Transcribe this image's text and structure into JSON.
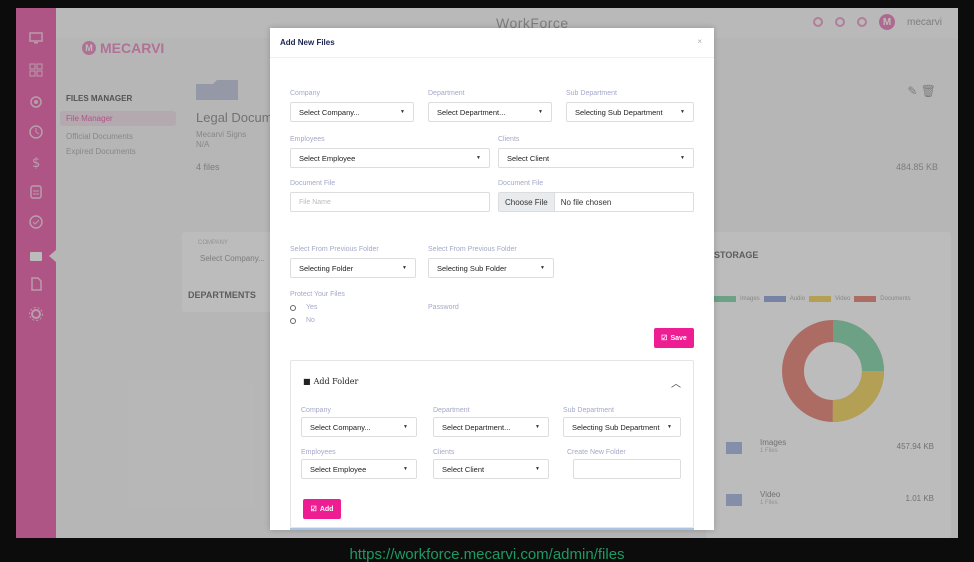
{
  "app": {
    "title": "WorkForce",
    "username": "mecarvi",
    "avatar_initial": "M",
    "logo": "MECARVI",
    "logo_mark": "M"
  },
  "sidebar": {
    "icons": [
      "monitor-icon",
      "grid-icon",
      "settings-icon",
      "clock-icon",
      "dollar-icon",
      "document-icon",
      "check-icon",
      "folder-icon",
      "file-icon",
      "gear-icon"
    ]
  },
  "files_manager": {
    "title": "FILES MANAGER",
    "items": [
      {
        "label": "File Manager"
      },
      {
        "label": "Official Documents"
      },
      {
        "label": "Expired Documents"
      }
    ]
  },
  "folder_detail": {
    "title": "Legal Docume",
    "sub1": "Mecarvi Signs",
    "sub2": "N/A",
    "count": "4 files",
    "size": "484.85 KB"
  },
  "left_card": {
    "label": "COMPANY",
    "select": "Select Company...",
    "departments": "DEPARTMENTS"
  },
  "storage": {
    "title": "STORAGE",
    "legend": [
      "Images",
      "Audio",
      "Video",
      "Documents"
    ],
    "rows": [
      {
        "name": "Images",
        "sub": "1 Files",
        "size": "457.94 KB"
      },
      {
        "name": "Video",
        "sub": "1 Files",
        "size": "1.01 KB"
      }
    ]
  },
  "colors": {
    "accent": "#ee1d91",
    "sidebar": "#e85aa9",
    "label": "#a4a8c8",
    "url": "#1d9a64",
    "donut": [
      "#e67e72",
      "#f0d25a",
      "#7fd3a8",
      "#8ea3d8"
    ]
  },
  "modal": {
    "title": "Add New Files",
    "close": "×",
    "company_label": "Company",
    "company_value": "Select Company...",
    "department_label": "Department",
    "department_value": "Select Department...",
    "subdept_label": "Sub Department",
    "subdept_value": "Selecting Sub Department",
    "employees_label": "Employees",
    "employees_value": "Select Employee",
    "clients_label": "Clients",
    "clients_value": "Select Client",
    "docfile_label": "Document File",
    "docfile_placeholder": "File Name",
    "docfile2_label": "Document File",
    "choose_file": "Choose File",
    "no_file": "No file chosen",
    "prev_folder_label": "Select From Previous Folder",
    "prev_folder_value": "Selecting Folder",
    "prev_subfolder_label": "Select From Previous Folder",
    "prev_subfolder_value": "Selecting Sub Folder",
    "protect_label": "Protect Your Files",
    "yes": "Yes",
    "no": "No",
    "password_label": "Password",
    "save": "Save",
    "add_folder": {
      "title": "Add Folder",
      "company_label": "Company",
      "company_value": "Select Company...",
      "department_label": "Department",
      "department_value": "Select Department...",
      "subdept_label": "Sub Department",
      "subdept_value": "Selecting Sub Department",
      "employees_label": "Employees",
      "employees_value": "Select Employee",
      "clients_label": "Clients",
      "clients_value": "Select Client",
      "new_folder_label": "Create New Folder",
      "add": "Add"
    }
  },
  "footer_url": "https://workforce.mecarvi.com/admin/files"
}
